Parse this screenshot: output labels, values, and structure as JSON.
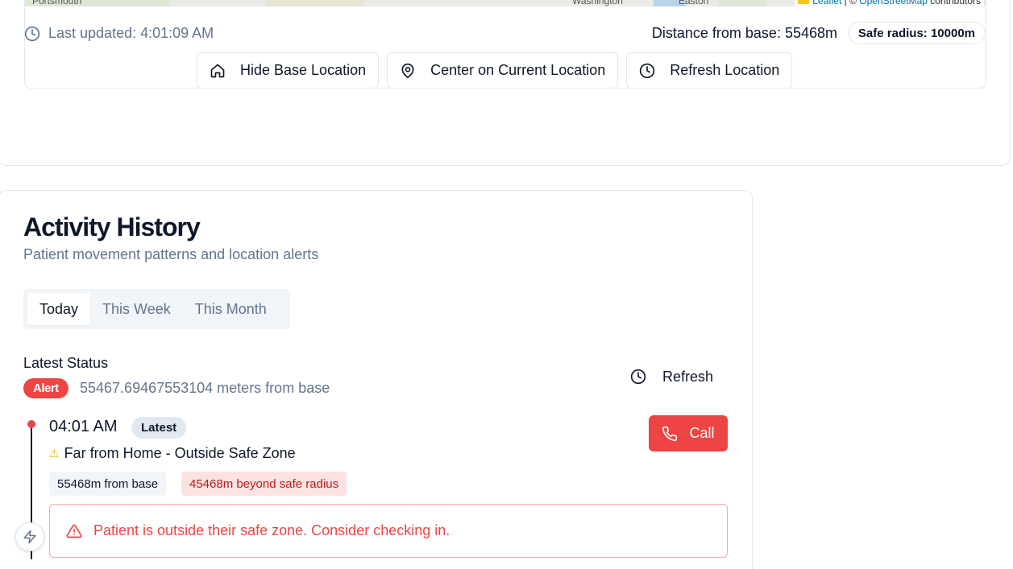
{
  "map": {
    "labels": [
      "Portsmouth",
      "Washington",
      "Easton"
    ],
    "attribution": {
      "leaflet": "Leaflet",
      "separator": " | © ",
      "osm": "OpenStreetMap",
      "contributors": " contributors"
    }
  },
  "status_bar": {
    "last_updated": "Last updated: 4:01:09 AM",
    "distance": "Distance from base: 55468m",
    "safe_radius": "Safe radius: 10000m"
  },
  "actions": {
    "hide_base": "Hide Base Location",
    "center": "Center on Current Location",
    "refresh_location": "Refresh Location"
  },
  "activity": {
    "title": "Activity History",
    "subtitle": "Patient movement patterns and location alerts",
    "tabs": [
      {
        "label": "Today",
        "active": true
      },
      {
        "label": "This Week",
        "active": false
      },
      {
        "label": "This Month",
        "active": false
      }
    ],
    "latest_status_label": "Latest Status",
    "alert_badge": "Alert",
    "meters_from_base": "55467.69467553104 meters from base",
    "refresh_label": "Refresh"
  },
  "timeline": {
    "time": "04:01 AM",
    "latest_badge": "Latest",
    "status": "Far from Home - Outside Safe Zone",
    "chip_distance": "55468m from base",
    "chip_beyond": "45468m beyond safe radius",
    "call_label": "Call",
    "alert_message": "Patient is outside their safe zone. Consider checking in."
  },
  "colors": {
    "alert_red": "#ef4444",
    "muted": "#64748b",
    "border": "#e2e8f0"
  }
}
